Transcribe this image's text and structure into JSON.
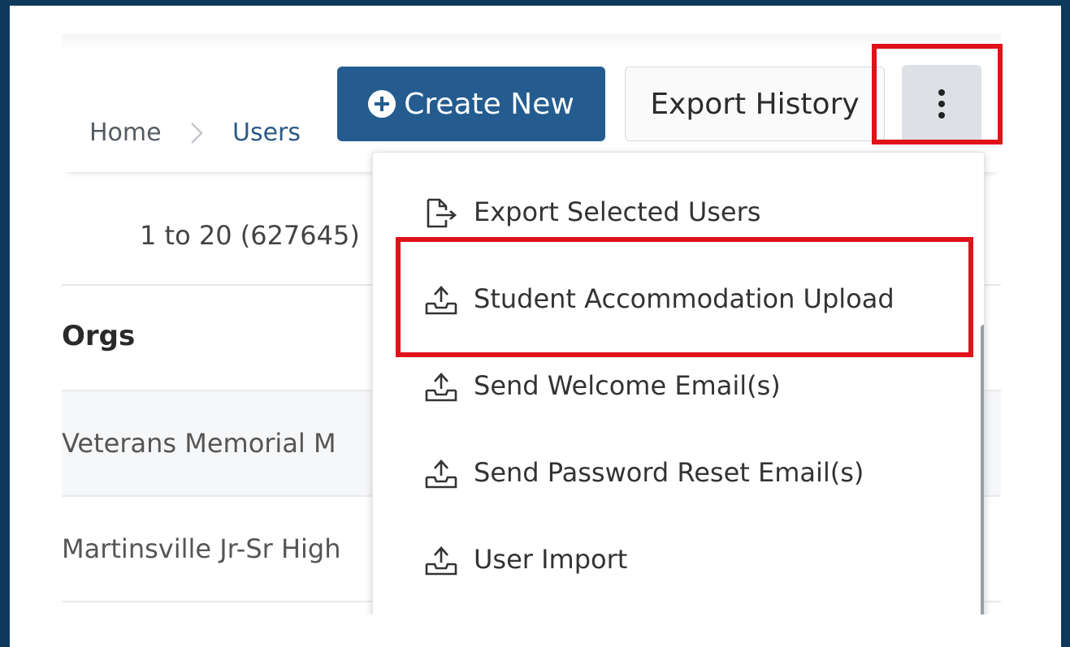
{
  "breadcrumb": {
    "home": "Home",
    "current": "Users"
  },
  "toolbar": {
    "create_label": "Create New",
    "export_label": "Export History",
    "more_icon": "kebab-vertical-icon"
  },
  "table": {
    "range_text": "1 to 20 (627645)",
    "column_orgs": "Orgs",
    "rows": [
      "Veterans Memorial M",
      "Martinsville Jr-Sr High"
    ]
  },
  "menu": {
    "items": [
      {
        "label": "Export Selected Users",
        "icon": "file-export-icon"
      },
      {
        "label": "Student Accommodation Upload",
        "icon": "upload-tray-icon"
      },
      {
        "label": "Send Welcome Email(s)",
        "icon": "upload-tray-icon"
      },
      {
        "label": "Send Password Reset Email(s)",
        "icon": "upload-tray-icon"
      },
      {
        "label": "User Import",
        "icon": "upload-tray-icon"
      }
    ]
  },
  "colors": {
    "primary": "#245c8f",
    "highlight": "#e0121a",
    "frame": "#0d3a5c"
  }
}
